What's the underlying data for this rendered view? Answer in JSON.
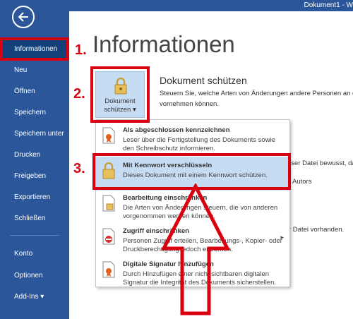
{
  "window": {
    "doc_title": "Dokument1 - W"
  },
  "sidebar": {
    "items": [
      {
        "label": "Informationen"
      },
      {
        "label": "Neu"
      },
      {
        "label": "Öffnen"
      },
      {
        "label": "Speichern"
      },
      {
        "label": "Speichern unter"
      },
      {
        "label": "Drucken"
      },
      {
        "label": "Freigeben"
      },
      {
        "label": "Exportieren"
      },
      {
        "label": "Schließen"
      },
      {
        "label": "Konto"
      },
      {
        "label": "Optionen"
      },
      {
        "label": "Add-Ins"
      }
    ]
  },
  "main": {
    "title": "Informationen",
    "protect_button": {
      "line1": "Dokument",
      "line2": "schützen"
    },
    "section_title": "Dokument schützen",
    "section_desc": "Steuern Sie, welche Arten von Änderungen andere Personen an d vornehmen können.",
    "bg_text_1": "eser Datei bewusst, da",
    "bg_text_2": "Autors",
    "bg_text_3": "r Datei vorhanden."
  },
  "menu": {
    "items": [
      {
        "title": "Als abgeschlossen kennzeichnen",
        "desc": "Leser über die Fertigstellung des Dokuments sowie den Schreibschutz informieren."
      },
      {
        "title": "Mit Kennwort verschlüsseln",
        "desc": "Dieses Dokument mit einem Kennwort schützen."
      },
      {
        "title": "Bearbeitung einschränken",
        "desc": "Die Arten von Änderungen steuern, die von anderen vorgenommen werden können."
      },
      {
        "title": "Zugriff einschränken",
        "desc": "Personen Zugriff erteilen, Bearbeitungs-, Kopier- oder Druckberechtigung jedoch entfernen."
      },
      {
        "title": "Digitale Signatur hinzufügen",
        "desc": "Durch Hinzufügen einer nicht sichtbaren digitalen Signatur die Integrität des Dokuments sicherstellen."
      }
    ]
  },
  "annotations": {
    "step1": "1.",
    "step2": "2.",
    "step3": "3."
  },
  "colors": {
    "sidebar": "#2b579a",
    "sidebar_active": "#124078",
    "highlight": "#c5dcf3",
    "annotation_red": "#d9000f"
  }
}
